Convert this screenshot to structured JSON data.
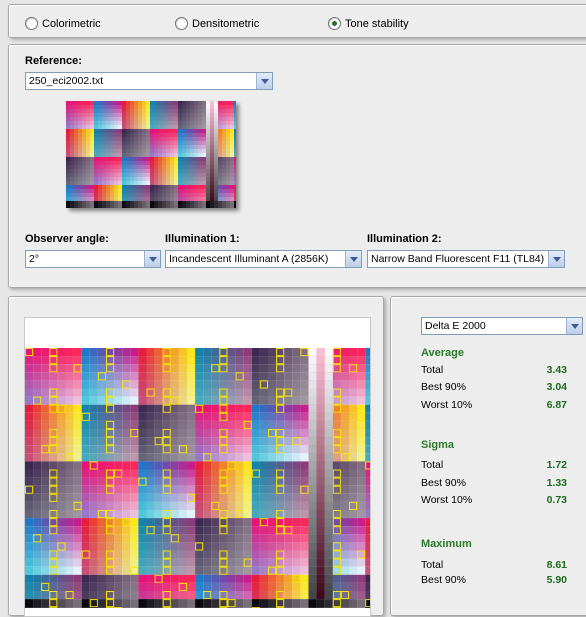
{
  "modes": {
    "colorimetric": "Colorimetric",
    "densitometric": "Densitometric",
    "tone_stability": "Tone stability",
    "selected": "tone_stability"
  },
  "reference": {
    "label": "Reference:",
    "file": "250_eci2002.txt"
  },
  "observer": {
    "label": "Observer angle:",
    "value": "2°"
  },
  "illum1": {
    "label": "Illumination 1:",
    "value": "Incandescent Illuminant A (2856K)"
  },
  "illum2": {
    "label": "Illumination 2:",
    "value": "Narrow Band Fluorescent F11 (TL84)"
  },
  "metric": {
    "value": "Delta E 2000"
  },
  "stats": {
    "average": {
      "title": "Average",
      "total_label": "Total",
      "total": "3.43",
      "best_label": "Best 90%",
      "best": "3.04",
      "worst_label": "Worst 10%",
      "worst": "6.87"
    },
    "sigma": {
      "title": "Sigma",
      "total_label": "Total",
      "total": "1.72",
      "best_label": "Best 90%",
      "best": "1.33",
      "worst_label": "Worst 10%",
      "worst": "0.73"
    },
    "maximum": {
      "title": "Maximum",
      "total_label": "Total",
      "total": "8.61",
      "best_label": "Best 90%",
      "best": "5.90"
    }
  },
  "colors": {
    "accent_green": "#1d6b1d",
    "highlight": "#f5e400"
  }
}
